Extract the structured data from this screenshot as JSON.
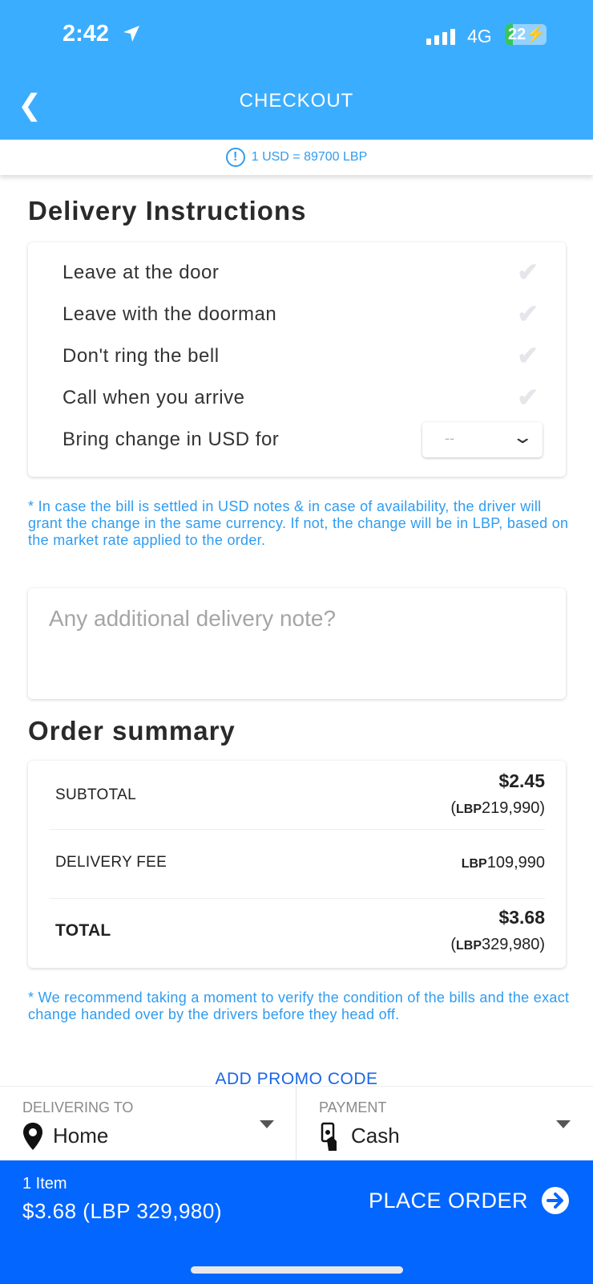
{
  "status_bar": {
    "time": "2:42",
    "network": "4G",
    "battery": "22"
  },
  "header": {
    "title": "CHECKOUT"
  },
  "exchange_rate": "1 USD = 89700 LBP",
  "delivery": {
    "heading": "Delivery Instructions",
    "options": [
      {
        "label": "Leave at the door"
      },
      {
        "label": "Leave with the doorman"
      },
      {
        "label": "Don't ring the bell"
      },
      {
        "label": "Call when you arrive"
      }
    ],
    "change_label": "Bring change in USD for",
    "change_value": "--",
    "disclaimer": "* In case the bill is settled in USD notes & in case of availability, the driver will grant the change in the same currency. If not, the change will be in LBP, based on the market rate applied to the order.",
    "note_placeholder": "Any additional delivery note?"
  },
  "summary": {
    "heading": "Order summary",
    "subtotal_label": "SUBTOTAL",
    "subtotal_usd": "$2.45",
    "subtotal_lbp": "219,990",
    "fee_label": "DELIVERY FEE",
    "fee_lbp": "109,990",
    "total_label": "TOTAL",
    "total_usd": "$3.68",
    "total_lbp": "329,980",
    "lbp": "LBP",
    "disclaimer": "* We recommend taking a moment to verify the condition of the bills and the exact change handed over by the drivers before they head off."
  },
  "promo": "ADD PROMO CODE",
  "delivering": {
    "label": "DELIVERING TO",
    "value": "Home"
  },
  "payment": {
    "label": "PAYMENT",
    "value": "Cash"
  },
  "footer": {
    "items": "1 Item",
    "total": "$3.68 (LBP 329,980)",
    "place_order": "PLACE ORDER"
  },
  "colors": {
    "header": "#3badff",
    "accent": "#2f9cf0",
    "footer": "#0366ff"
  }
}
